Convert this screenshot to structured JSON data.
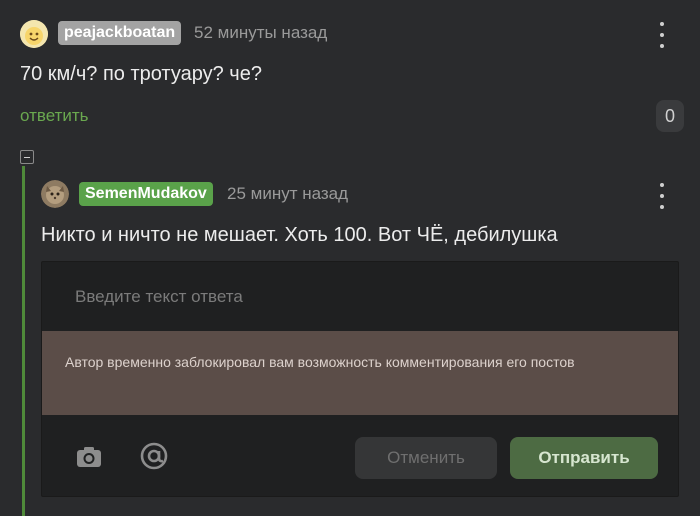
{
  "comment1": {
    "username": "peajackboatan",
    "time": "52 минуты назад",
    "text": "70 км/ч? по тротуару? че?",
    "reply_label": "ответить",
    "rating": "0",
    "avatar_icon": "smiley-avatar-icon",
    "badge_color": "#a3a3a3"
  },
  "comment2": {
    "username": "SemenMudakov",
    "time": "25 минут назад",
    "text": "Никто и ничто не мешает. Хоть 100. Вот ЧЁ, дебилушка",
    "avatar_icon": "cat-avatar-icon",
    "badge_color": "#5aa24a"
  },
  "reply_form": {
    "placeholder": "Введите текст ответа",
    "blocked_notice": "Автор временно заблокировал вам возможность комментирования его постов",
    "cancel_label": "Отменить",
    "submit_label": "Отправить",
    "camera_icon": "camera-icon",
    "mention_icon": "at-sign-icon"
  },
  "thread": {
    "collapse_icon": "collapse-minus-icon",
    "line_color": "#4f8a3a"
  }
}
